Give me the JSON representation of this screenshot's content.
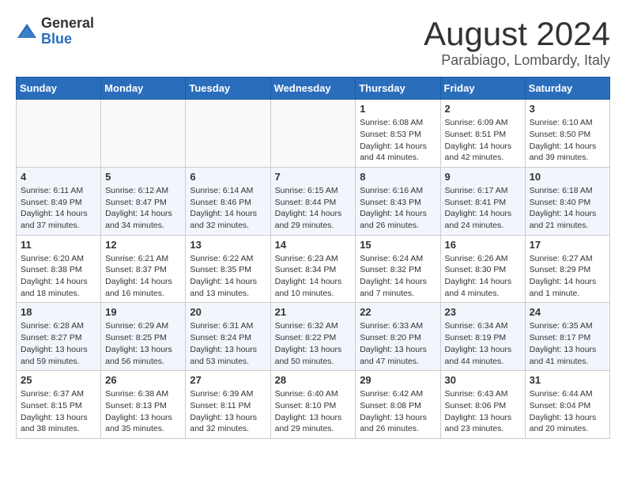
{
  "header": {
    "logo_line1": "General",
    "logo_line2": "Blue",
    "month_title": "August 2024",
    "location": "Parabiago, Lombardy, Italy"
  },
  "weekdays": [
    "Sunday",
    "Monday",
    "Tuesday",
    "Wednesday",
    "Thursday",
    "Friday",
    "Saturday"
  ],
  "weeks": [
    [
      {
        "day": "",
        "info": ""
      },
      {
        "day": "",
        "info": ""
      },
      {
        "day": "",
        "info": ""
      },
      {
        "day": "",
        "info": ""
      },
      {
        "day": "1",
        "info": "Sunrise: 6:08 AM\nSunset: 8:53 PM\nDaylight: 14 hours\nand 44 minutes."
      },
      {
        "day": "2",
        "info": "Sunrise: 6:09 AM\nSunset: 8:51 PM\nDaylight: 14 hours\nand 42 minutes."
      },
      {
        "day": "3",
        "info": "Sunrise: 6:10 AM\nSunset: 8:50 PM\nDaylight: 14 hours\nand 39 minutes."
      }
    ],
    [
      {
        "day": "4",
        "info": "Sunrise: 6:11 AM\nSunset: 8:49 PM\nDaylight: 14 hours\nand 37 minutes."
      },
      {
        "day": "5",
        "info": "Sunrise: 6:12 AM\nSunset: 8:47 PM\nDaylight: 14 hours\nand 34 minutes."
      },
      {
        "day": "6",
        "info": "Sunrise: 6:14 AM\nSunset: 8:46 PM\nDaylight: 14 hours\nand 32 minutes."
      },
      {
        "day": "7",
        "info": "Sunrise: 6:15 AM\nSunset: 8:44 PM\nDaylight: 14 hours\nand 29 minutes."
      },
      {
        "day": "8",
        "info": "Sunrise: 6:16 AM\nSunset: 8:43 PM\nDaylight: 14 hours\nand 26 minutes."
      },
      {
        "day": "9",
        "info": "Sunrise: 6:17 AM\nSunset: 8:41 PM\nDaylight: 14 hours\nand 24 minutes."
      },
      {
        "day": "10",
        "info": "Sunrise: 6:18 AM\nSunset: 8:40 PM\nDaylight: 14 hours\nand 21 minutes."
      }
    ],
    [
      {
        "day": "11",
        "info": "Sunrise: 6:20 AM\nSunset: 8:38 PM\nDaylight: 14 hours\nand 18 minutes."
      },
      {
        "day": "12",
        "info": "Sunrise: 6:21 AM\nSunset: 8:37 PM\nDaylight: 14 hours\nand 16 minutes."
      },
      {
        "day": "13",
        "info": "Sunrise: 6:22 AM\nSunset: 8:35 PM\nDaylight: 14 hours\nand 13 minutes."
      },
      {
        "day": "14",
        "info": "Sunrise: 6:23 AM\nSunset: 8:34 PM\nDaylight: 14 hours\nand 10 minutes."
      },
      {
        "day": "15",
        "info": "Sunrise: 6:24 AM\nSunset: 8:32 PM\nDaylight: 14 hours\nand 7 minutes."
      },
      {
        "day": "16",
        "info": "Sunrise: 6:26 AM\nSunset: 8:30 PM\nDaylight: 14 hours\nand 4 minutes."
      },
      {
        "day": "17",
        "info": "Sunrise: 6:27 AM\nSunset: 8:29 PM\nDaylight: 14 hours\nand 1 minute."
      }
    ],
    [
      {
        "day": "18",
        "info": "Sunrise: 6:28 AM\nSunset: 8:27 PM\nDaylight: 13 hours\nand 59 minutes."
      },
      {
        "day": "19",
        "info": "Sunrise: 6:29 AM\nSunset: 8:25 PM\nDaylight: 13 hours\nand 56 minutes."
      },
      {
        "day": "20",
        "info": "Sunrise: 6:31 AM\nSunset: 8:24 PM\nDaylight: 13 hours\nand 53 minutes."
      },
      {
        "day": "21",
        "info": "Sunrise: 6:32 AM\nSunset: 8:22 PM\nDaylight: 13 hours\nand 50 minutes."
      },
      {
        "day": "22",
        "info": "Sunrise: 6:33 AM\nSunset: 8:20 PM\nDaylight: 13 hours\nand 47 minutes."
      },
      {
        "day": "23",
        "info": "Sunrise: 6:34 AM\nSunset: 8:19 PM\nDaylight: 13 hours\nand 44 minutes."
      },
      {
        "day": "24",
        "info": "Sunrise: 6:35 AM\nSunset: 8:17 PM\nDaylight: 13 hours\nand 41 minutes."
      }
    ],
    [
      {
        "day": "25",
        "info": "Sunrise: 6:37 AM\nSunset: 8:15 PM\nDaylight: 13 hours\nand 38 minutes."
      },
      {
        "day": "26",
        "info": "Sunrise: 6:38 AM\nSunset: 8:13 PM\nDaylight: 13 hours\nand 35 minutes."
      },
      {
        "day": "27",
        "info": "Sunrise: 6:39 AM\nSunset: 8:11 PM\nDaylight: 13 hours\nand 32 minutes."
      },
      {
        "day": "28",
        "info": "Sunrise: 6:40 AM\nSunset: 8:10 PM\nDaylight: 13 hours\nand 29 minutes."
      },
      {
        "day": "29",
        "info": "Sunrise: 6:42 AM\nSunset: 8:08 PM\nDaylight: 13 hours\nand 26 minutes."
      },
      {
        "day": "30",
        "info": "Sunrise: 6:43 AM\nSunset: 8:06 PM\nDaylight: 13 hours\nand 23 minutes."
      },
      {
        "day": "31",
        "info": "Sunrise: 6:44 AM\nSunset: 8:04 PM\nDaylight: 13 hours\nand 20 minutes."
      }
    ]
  ]
}
